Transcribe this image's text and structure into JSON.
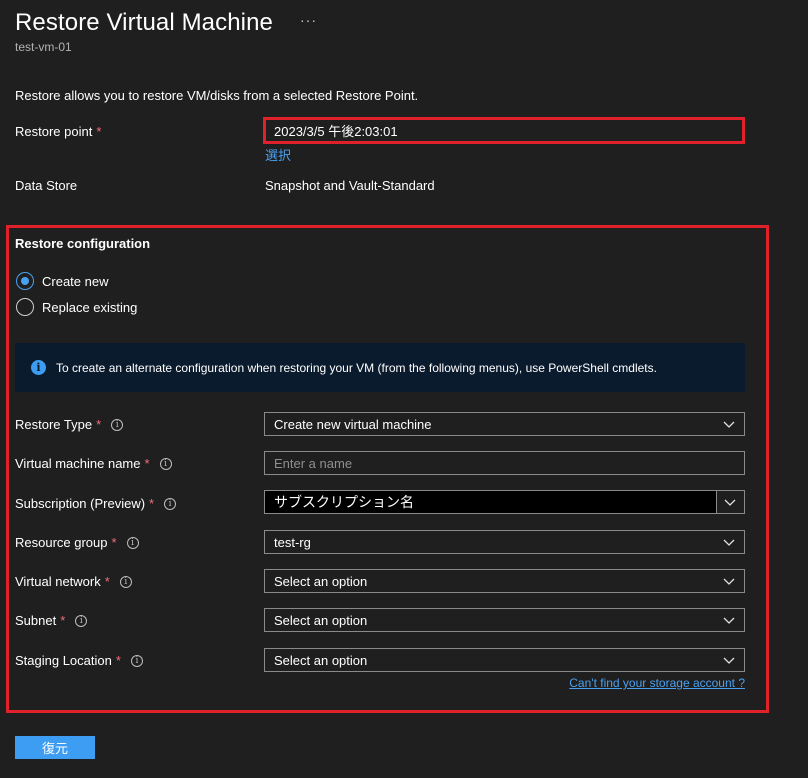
{
  "header": {
    "title": "Restore Virtual Machine",
    "more": "···",
    "subtitle": "test-vm-01"
  },
  "intro": "Restore allows you to restore VM/disks from a selected Restore Point.",
  "restore_point": {
    "label": "Restore point",
    "required": "*",
    "value": "2023/3/5 午後2:03:01",
    "select_link": "選択"
  },
  "data_store": {
    "label": "Data Store",
    "value": "Snapshot and Vault-Standard"
  },
  "config": {
    "title": "Restore configuration",
    "options": [
      {
        "label": "Create new",
        "checked": true
      },
      {
        "label": "Replace existing",
        "checked": false
      }
    ],
    "info": "To create an alternate configuration when restoring your VM (from the following menus), use PowerShell cmdlets.",
    "fields": {
      "restore_type": {
        "label": "Restore Type",
        "value": "Create new virtual machine"
      },
      "vm_name": {
        "label": "Virtual machine name",
        "placeholder": "Enter a name"
      },
      "subscription": {
        "label": "Subscription (Preview)",
        "value": "サブスクリプション名"
      },
      "resource_group": {
        "label": "Resource group",
        "value": "test-rg"
      },
      "virtual_network": {
        "label": "Virtual network",
        "value": "Select an option"
      },
      "subnet": {
        "label": "Subnet",
        "value": "Select an option"
      },
      "staging_location": {
        "label": "Staging Location",
        "value": "Select an option"
      }
    },
    "required_mark": "*",
    "info_icon": "i",
    "storage_link": "Can't find your storage account ?"
  },
  "footer": {
    "restore_button": "復元"
  },
  "colors": {
    "background": "#1f1f1f",
    "accent": "#3d9df2",
    "highlight": "#e0202a",
    "required": "#f1707b"
  }
}
